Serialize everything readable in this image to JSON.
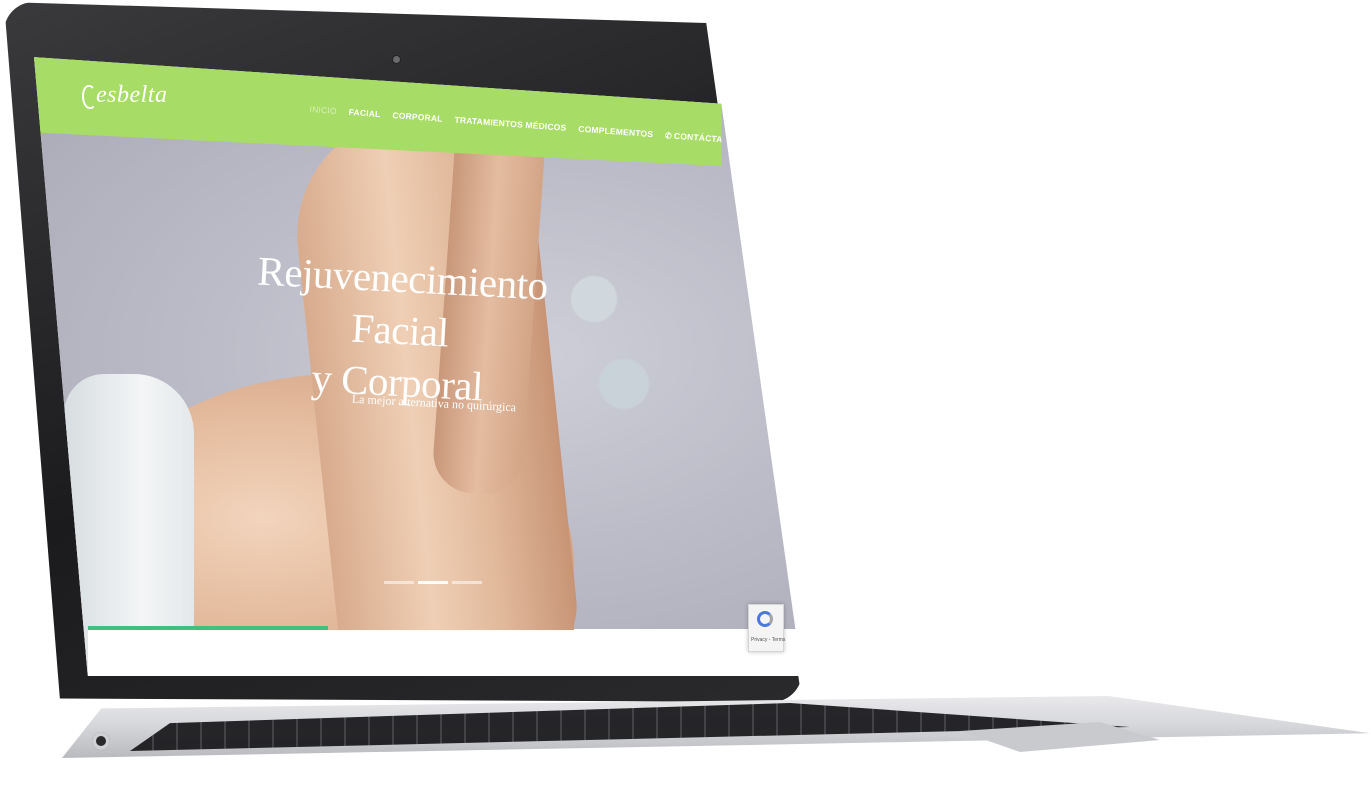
{
  "site": {
    "logo_text": "esbelta",
    "nav": [
      {
        "label": "INICIO",
        "active": true
      },
      {
        "label": "FACIAL",
        "active": false
      },
      {
        "label": "CORPORAL",
        "active": false
      },
      {
        "label": "TRATAMIENTOS MÉDICOS",
        "active": false
      },
      {
        "label": "COMPLEMENTOS",
        "active": false
      },
      {
        "label": "CONTÁCTANOS",
        "active": false,
        "icon": "phone-icon"
      }
    ]
  },
  "hero": {
    "title_line1": "Rejuvenecimiento Facial",
    "title_line2": "y Corporal",
    "subtitle": "La mejor alternativa no quirúrgica",
    "slides_total": 3,
    "slide_active": 2
  },
  "recaptcha": {
    "text": "Privacy - Terms"
  },
  "colors": {
    "header_green": "#a7dc66",
    "progress_green": "#3fc07f"
  }
}
